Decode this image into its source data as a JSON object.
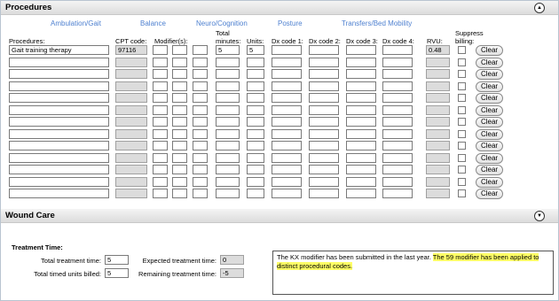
{
  "procedures_section": {
    "title": "Procedures",
    "tabs": [
      "Ambulation/Gait",
      "Balance",
      "Neuro/Cognition",
      "Posture",
      "Transfers/Bed Mobility"
    ],
    "headers": {
      "procedures": "Procedures:",
      "cpt": "CPT code:",
      "modifiers": "Modifier(s):",
      "total_minutes_1": "Total",
      "total_minutes_2": "minutes:",
      "units": "Units:",
      "dx1": "Dx code 1:",
      "dx2": "Dx code 2:",
      "dx3": "Dx code 3:",
      "dx4": "Dx code 4:",
      "rvu": "RVU:",
      "suppress_1": "Suppress",
      "suppress_2": "billing:"
    },
    "clear_label": "Clear",
    "rows": [
      {
        "procedure": "Gait training therapy",
        "cpt": "97116",
        "minutes": "5",
        "units": "5",
        "rvu": "0.48"
      },
      {
        "procedure": "",
        "cpt": "",
        "minutes": "",
        "units": "",
        "rvu": ""
      },
      {
        "procedure": "",
        "cpt": "",
        "minutes": "",
        "units": "",
        "rvu": ""
      },
      {
        "procedure": "",
        "cpt": "",
        "minutes": "",
        "units": "",
        "rvu": ""
      },
      {
        "procedure": "",
        "cpt": "",
        "minutes": "",
        "units": "",
        "rvu": ""
      },
      {
        "procedure": "",
        "cpt": "",
        "minutes": "",
        "units": "",
        "rvu": ""
      },
      {
        "procedure": "",
        "cpt": "",
        "minutes": "",
        "units": "",
        "rvu": ""
      },
      {
        "procedure": "",
        "cpt": "",
        "minutes": "",
        "units": "",
        "rvu": ""
      },
      {
        "procedure": "",
        "cpt": "",
        "minutes": "",
        "units": "",
        "rvu": ""
      },
      {
        "procedure": "",
        "cpt": "",
        "minutes": "",
        "units": "",
        "rvu": ""
      },
      {
        "procedure": "",
        "cpt": "",
        "minutes": "",
        "units": "",
        "rvu": ""
      },
      {
        "procedure": "",
        "cpt": "",
        "minutes": "",
        "units": "",
        "rvu": ""
      },
      {
        "procedure": "",
        "cpt": "",
        "minutes": "",
        "units": "",
        "rvu": ""
      }
    ]
  },
  "wound_care": {
    "title": "Wound Care"
  },
  "treatment": {
    "heading": "Treatment Time:",
    "total_treatment_label": "Total treatment time:",
    "total_treatment_value": "5",
    "total_timed_label": "Total timed units billed:",
    "total_timed_value": "5",
    "expected_label": "Expected treatment time:",
    "expected_value": "0",
    "remaining_label": "Remaining treatment time:",
    "remaining_value": "-5",
    "note_plain": "The KX modifier has been submitted in the last year. ",
    "note_highlight": "The 59 modifier has been applied to distinct procedural codes."
  },
  "icons": {
    "collapse_up": "chevron-up-icon",
    "expand_down": "chevron-down-icon"
  },
  "colors": {
    "tab_link": "#4f81d0",
    "highlight": "#ffff66",
    "readonly_field": "#dcdcdc"
  }
}
